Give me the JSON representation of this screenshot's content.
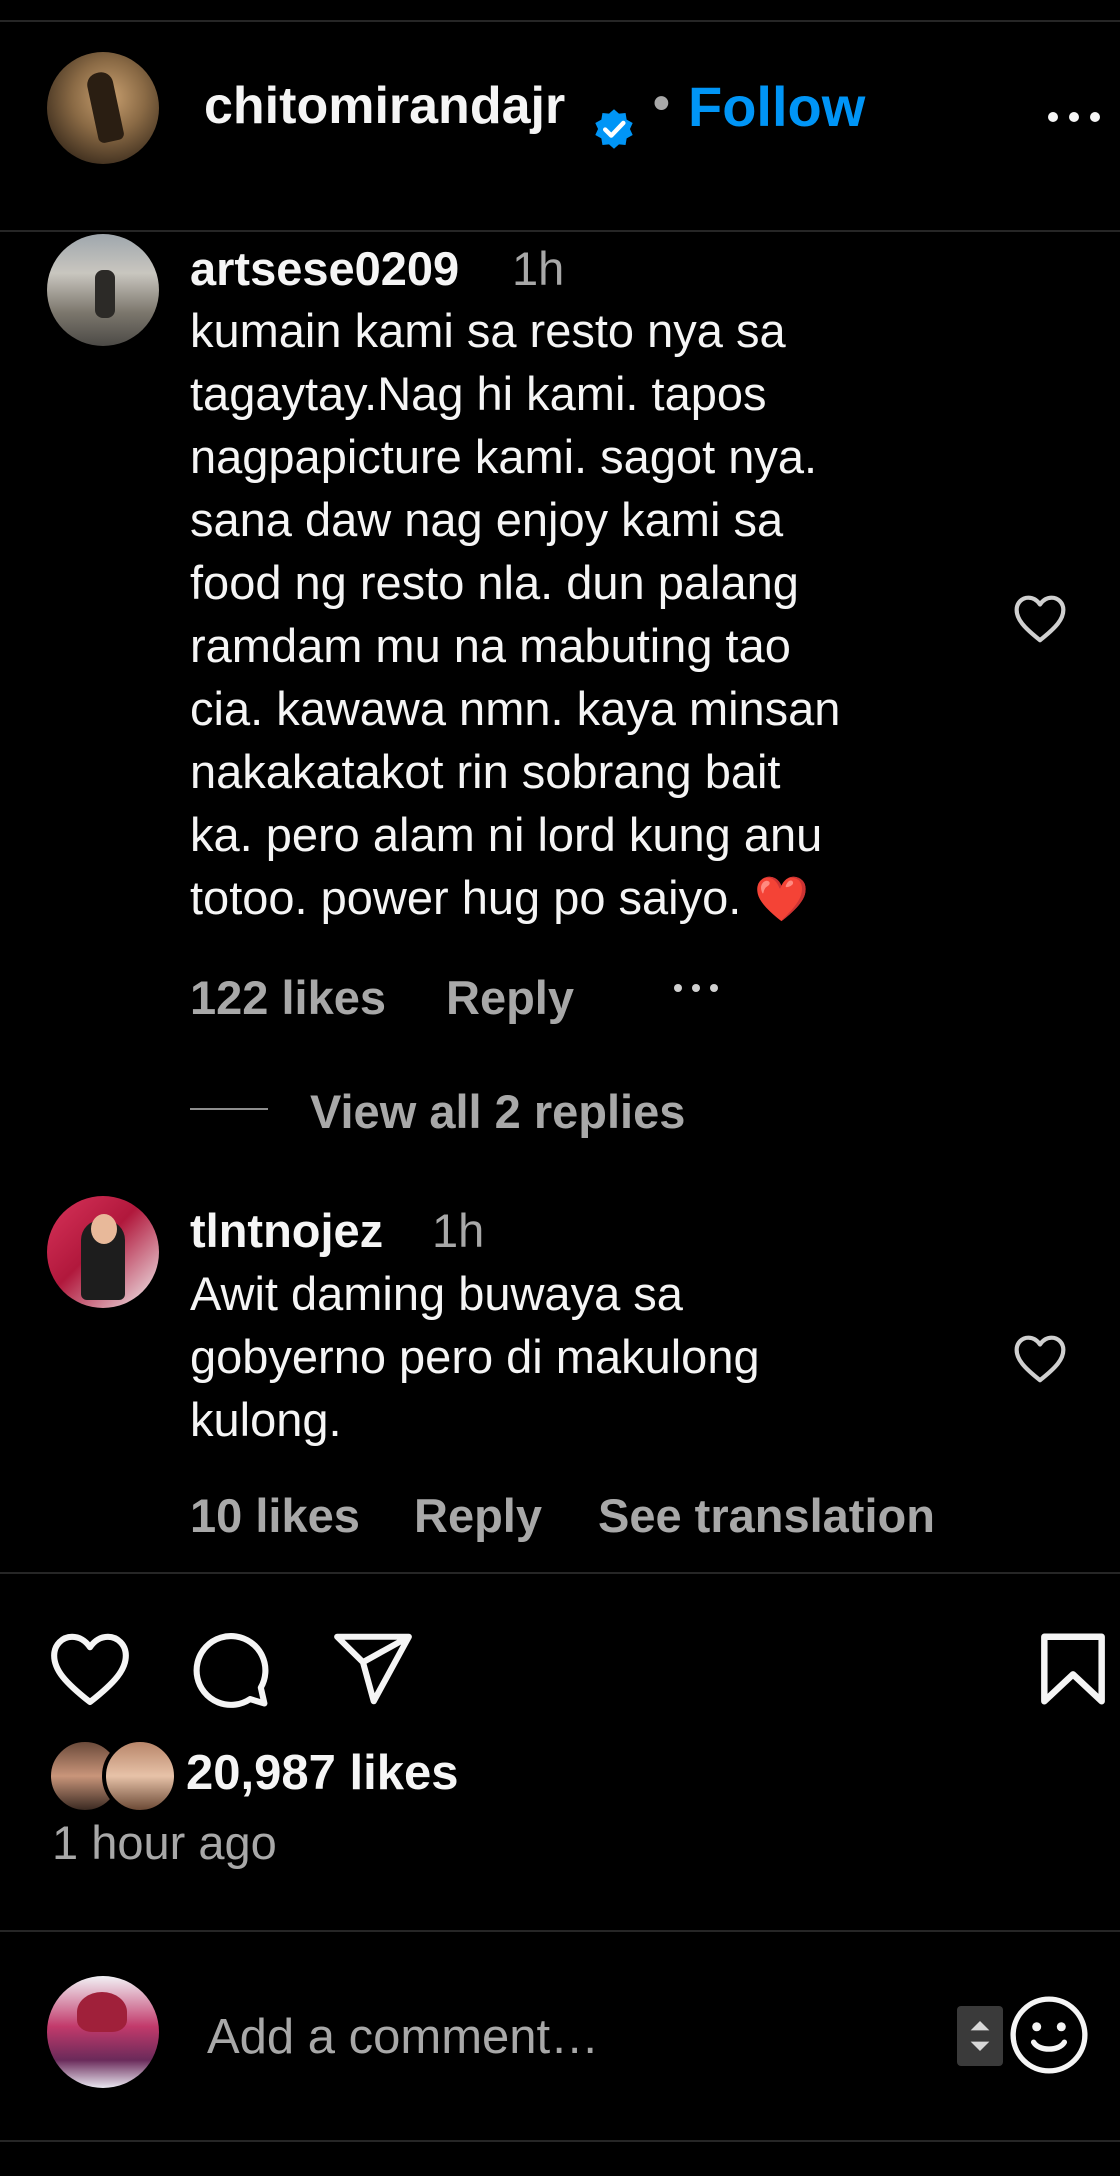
{
  "header": {
    "username": "chitomirandajr",
    "separator": "•",
    "follow_label": "Follow",
    "icons": {
      "verified": "verified-badge-icon",
      "more": "more-horizontal-icon"
    },
    "accent_color": "#0095f6"
  },
  "comments": [
    {
      "username": "artsese0209",
      "time": "1h",
      "text": "kumain kami sa resto nya sa\ntagaytay.Nag hi kami. tapos\nnagpapicture kami. sagot nya.\nsana daw nag enjoy kami sa\nfood ng resto nla. dun palang\nramdam mu na mabuting tao\ncia. kawawa nmn. kaya minsan\nnakakatakot rin sobrang bait\nka. pero alam ni lord kung anu\ntotoo. power hug po saiyo.",
      "emoji": "❤️",
      "likes": "122 likes",
      "reply_label": "Reply",
      "view_replies": "View all 2 replies"
    },
    {
      "username": "tlntnojez",
      "time": "1h",
      "text": "Awit daming buwaya sa\ngobyerno pero di makulong\nkulong.",
      "likes": "10 likes",
      "reply_label": "Reply",
      "translation_label": "See translation"
    }
  ],
  "actions": {
    "icons": [
      "heart-icon",
      "comment-icon",
      "share-icon",
      "bookmark-icon"
    ]
  },
  "post": {
    "likes": "20,987 likes",
    "time_ago": "1 hour ago"
  },
  "add_comment": {
    "placeholder": "Add a comment…",
    "icons": {
      "emoji": "emoji-icon",
      "stepper": "stepper-icon"
    }
  }
}
